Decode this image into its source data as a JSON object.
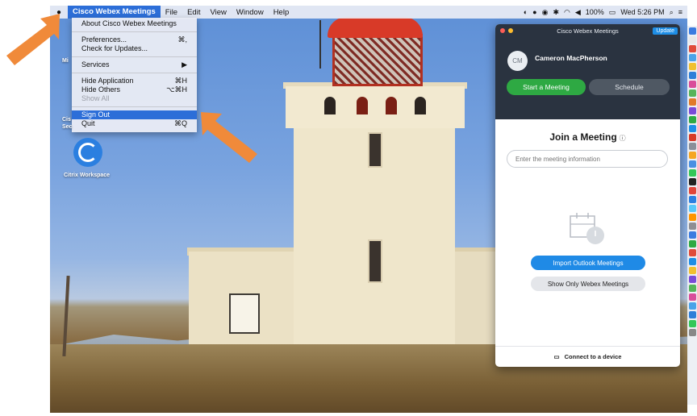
{
  "menubar": {
    "app_name": "Cisco Webex Meetings",
    "menus": [
      "File",
      "Edit",
      "View",
      "Window",
      "Help"
    ],
    "status": {
      "battery": "100%",
      "clock": "Wed 5:26 PM"
    }
  },
  "app_menu": {
    "about": "About Cisco Webex Meetings",
    "preferences": "Preferences...",
    "preferences_shortcut": "⌘,",
    "check_updates": "Check for Updates...",
    "services": "Services",
    "hide_application": "Hide Application",
    "hide_application_shortcut": "⌘H",
    "hide_others": "Hide Others",
    "hide_others_shortcut": "⌥⌘H",
    "show_all": "Show All",
    "sign_out": "Sign Out",
    "quit": "Quit",
    "quit_shortcut": "⌘Q"
  },
  "desktop_icons": {
    "citrix_label": "Citrix Workspace",
    "partial_1": "Mi",
    "partial_2": "Cis",
    "partial_3": "Sec"
  },
  "webex_window": {
    "title": "Cisco Webex Meetings",
    "update_label": "Update",
    "avatar_initials": "CM",
    "user_name": "Cameron MacPherson",
    "start_meeting": "Start a Meeting",
    "schedule": "Schedule",
    "join_title": "Join a Meeting",
    "join_input_placeholder": "Enter the meeting information",
    "import_outlook": "Import Outlook Meetings",
    "show_only_webex": "Show Only Webex Meetings",
    "connect_device": "Connect to a device"
  },
  "colors": {
    "menu_highlight": "#2c6ed8",
    "start_green": "#2ea943",
    "import_blue": "#1f8ae6",
    "arrow_orange": "#f08a3a"
  }
}
